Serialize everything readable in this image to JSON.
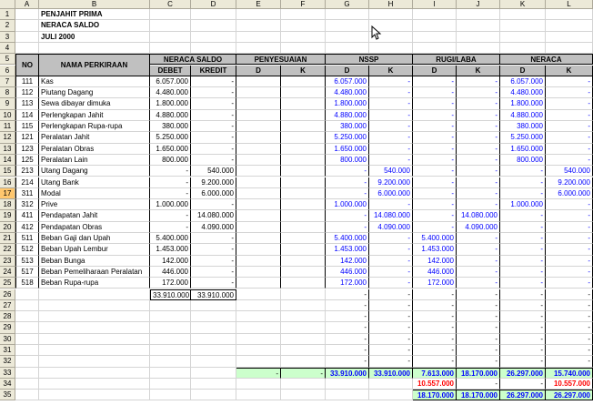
{
  "columns": [
    "A",
    "B",
    "C",
    "D",
    "E",
    "F",
    "G",
    "H",
    "I",
    "J",
    "K",
    "L"
  ],
  "rows": [
    "1",
    "2",
    "3",
    "4",
    "5",
    "6",
    "7",
    "8",
    "9",
    "10",
    "11",
    "12",
    "13",
    "14",
    "15",
    "16",
    "17",
    "18",
    "19",
    "20",
    "21",
    "22",
    "23",
    "24",
    "25",
    "26",
    "27",
    "28",
    "29",
    "30",
    "31",
    "32",
    "33",
    "34",
    "35"
  ],
  "selected_row": "17",
  "title": {
    "l1": "PENJAHIT PRIMA",
    "l2": "NERACA SALDO",
    "l3": "JULI 2000"
  },
  "headers": {
    "no": "NO",
    "nama": "NAMA PERKIRAAN",
    "neraca_saldo": "NERACA SALDO",
    "debet": "DEBET",
    "kredit": "KREDIT",
    "penyesuaian": "PENYESUAIAN",
    "nssp": "NSSP",
    "rugi_laba": "RUGI/LABA",
    "neraca": "NERACA",
    "d": "D",
    "k": "K"
  },
  "accounts": [
    {
      "no": "111",
      "nama": "Kas",
      "debet": "6.057.000",
      "kredit": "-",
      "nssp_d": "6.057.000",
      "nssp_k": "-",
      "rl_d": "-",
      "rl_k": "-",
      "n_d": "6.057.000",
      "n_k": "-"
    },
    {
      "no": "112",
      "nama": "Piutang Dagang",
      "debet": "4.480.000",
      "kredit": "-",
      "nssp_d": "4.480.000",
      "nssp_k": "-",
      "rl_d": "-",
      "rl_k": "-",
      "n_d": "4.480.000",
      "n_k": "-"
    },
    {
      "no": "113",
      "nama": "Sewa dibayar dimuka",
      "debet": "1.800.000",
      "kredit": "-",
      "nssp_d": "1.800.000",
      "nssp_k": "-",
      "rl_d": "-",
      "rl_k": "-",
      "n_d": "1.800.000",
      "n_k": "-"
    },
    {
      "no": "114",
      "nama": "Perlengkapan Jahit",
      "debet": "4.880.000",
      "kredit": "-",
      "nssp_d": "4.880.000",
      "nssp_k": "-",
      "rl_d": "-",
      "rl_k": "-",
      "n_d": "4.880.000",
      "n_k": "-"
    },
    {
      "no": "115",
      "nama": "Perlengkapan Rupa-rupa",
      "debet": "380.000",
      "kredit": "-",
      "nssp_d": "380.000",
      "nssp_k": "-",
      "rl_d": "-",
      "rl_k": "-",
      "n_d": "380.000",
      "n_k": "-"
    },
    {
      "no": "121",
      "nama": "Peralatan Jahit",
      "debet": "5.250.000",
      "kredit": "-",
      "nssp_d": "5.250.000",
      "nssp_k": "-",
      "rl_d": "-",
      "rl_k": "-",
      "n_d": "5.250.000",
      "n_k": "-"
    },
    {
      "no": "123",
      "nama": "Peralatan Obras",
      "debet": "1.650.000",
      "kredit": "-",
      "nssp_d": "1.650.000",
      "nssp_k": "-",
      "rl_d": "-",
      "rl_k": "-",
      "n_d": "1.650.000",
      "n_k": "-"
    },
    {
      "no": "125",
      "nama": "Peralatan Lain",
      "debet": "800.000",
      "kredit": "-",
      "nssp_d": "800.000",
      "nssp_k": "-",
      "rl_d": "-",
      "rl_k": "-",
      "n_d": "800.000",
      "n_k": "-"
    },
    {
      "no": "213",
      "nama": "Utang Dagang",
      "debet": "-",
      "kredit": "540.000",
      "nssp_d": "-",
      "nssp_k": "540.000",
      "rl_d": "-",
      "rl_k": "-",
      "n_d": "-",
      "n_k": "540.000"
    },
    {
      "no": "214",
      "nama": "Utang Bank",
      "debet": "-",
      "kredit": "9.200.000",
      "nssp_d": "-",
      "nssp_k": "9.200.000",
      "rl_d": "-",
      "rl_k": "-",
      "n_d": "-",
      "n_k": "9.200.000"
    },
    {
      "no": "311",
      "nama": "Modal",
      "debet": "-",
      "kredit": "6.000.000",
      "nssp_d": "-",
      "nssp_k": "6.000.000",
      "rl_d": "-",
      "rl_k": "-",
      "n_d": "-",
      "n_k": "6.000.000"
    },
    {
      "no": "312",
      "nama": "Prive",
      "debet": "1.000.000",
      "kredit": "-",
      "nssp_d": "1.000.000",
      "nssp_k": "-",
      "rl_d": "-",
      "rl_k": "-",
      "n_d": "1.000.000",
      "n_k": "-"
    },
    {
      "no": "411",
      "nama": "Pendapatan Jahit",
      "debet": "-",
      "kredit": "14.080.000",
      "nssp_d": "-",
      "nssp_k": "14.080.000",
      "rl_d": "-",
      "rl_k": "14.080.000",
      "n_d": "-",
      "n_k": "-"
    },
    {
      "no": "412",
      "nama": "Pendapatan Obras",
      "debet": "-",
      "kredit": "4.090.000",
      "nssp_d": "-",
      "nssp_k": "4.090.000",
      "rl_d": "-",
      "rl_k": "4.090.000",
      "n_d": "-",
      "n_k": "-"
    },
    {
      "no": "511",
      "nama": "Beban Gaji dan Upah",
      "debet": "5.400.000",
      "kredit": "-",
      "nssp_d": "5.400.000",
      "nssp_k": "-",
      "rl_d": "5.400.000",
      "rl_k": "-",
      "n_d": "-",
      "n_k": "-"
    },
    {
      "no": "512",
      "nama": "Beban Upah Lembur",
      "debet": "1.453.000",
      "kredit": "-",
      "nssp_d": "1.453.000",
      "nssp_k": "-",
      "rl_d": "1.453.000",
      "rl_k": "-",
      "n_d": "-",
      "n_k": "-"
    },
    {
      "no": "513",
      "nama": "Beban Bunga",
      "debet": "142.000",
      "kredit": "-",
      "nssp_d": "142.000",
      "nssp_k": "-",
      "rl_d": "142.000",
      "rl_k": "-",
      "n_d": "-",
      "n_k": "-"
    },
    {
      "no": "517",
      "nama": "Beban Pemeliharaan Peralatan",
      "debet": "446.000",
      "kredit": "-",
      "nssp_d": "446.000",
      "nssp_k": "-",
      "rl_d": "446.000",
      "rl_k": "-",
      "n_d": "-",
      "n_k": "-"
    },
    {
      "no": "518",
      "nama": "Beban Rupa-rupa",
      "debet": "172.000",
      "kredit": "-",
      "nssp_d": "172.000",
      "nssp_k": "-",
      "rl_d": "172.000",
      "rl_k": "-",
      "n_d": "-",
      "n_k": "-"
    }
  ],
  "total_saldo": {
    "debet": "33.910.000",
    "kredit": "33.910.000"
  },
  "empty_row_dash": "-",
  "total33": {
    "p_d": "-",
    "p_k": "-",
    "nssp_d": "33.910.000",
    "nssp_k": "33.910.000",
    "rl_d": "7.613.000",
    "rl_k": "18.170.000",
    "n_d": "26.297.000",
    "n_k": "15.740.000"
  },
  "row34": {
    "rl_d": "10.557.000",
    "rl_k": "-",
    "n_d": "-",
    "n_k": "10.557.000"
  },
  "row35": {
    "rl_d": "18.170.000",
    "rl_k": "18.170.000",
    "n_d": "26.297.000",
    "n_k": "26.297.000"
  },
  "colors": {
    "blue": "#0000ff",
    "red": "#ff0000",
    "green": "#ccffcc",
    "header_gray": "#c0c0c0",
    "selected_row": "#ffc76e"
  }
}
